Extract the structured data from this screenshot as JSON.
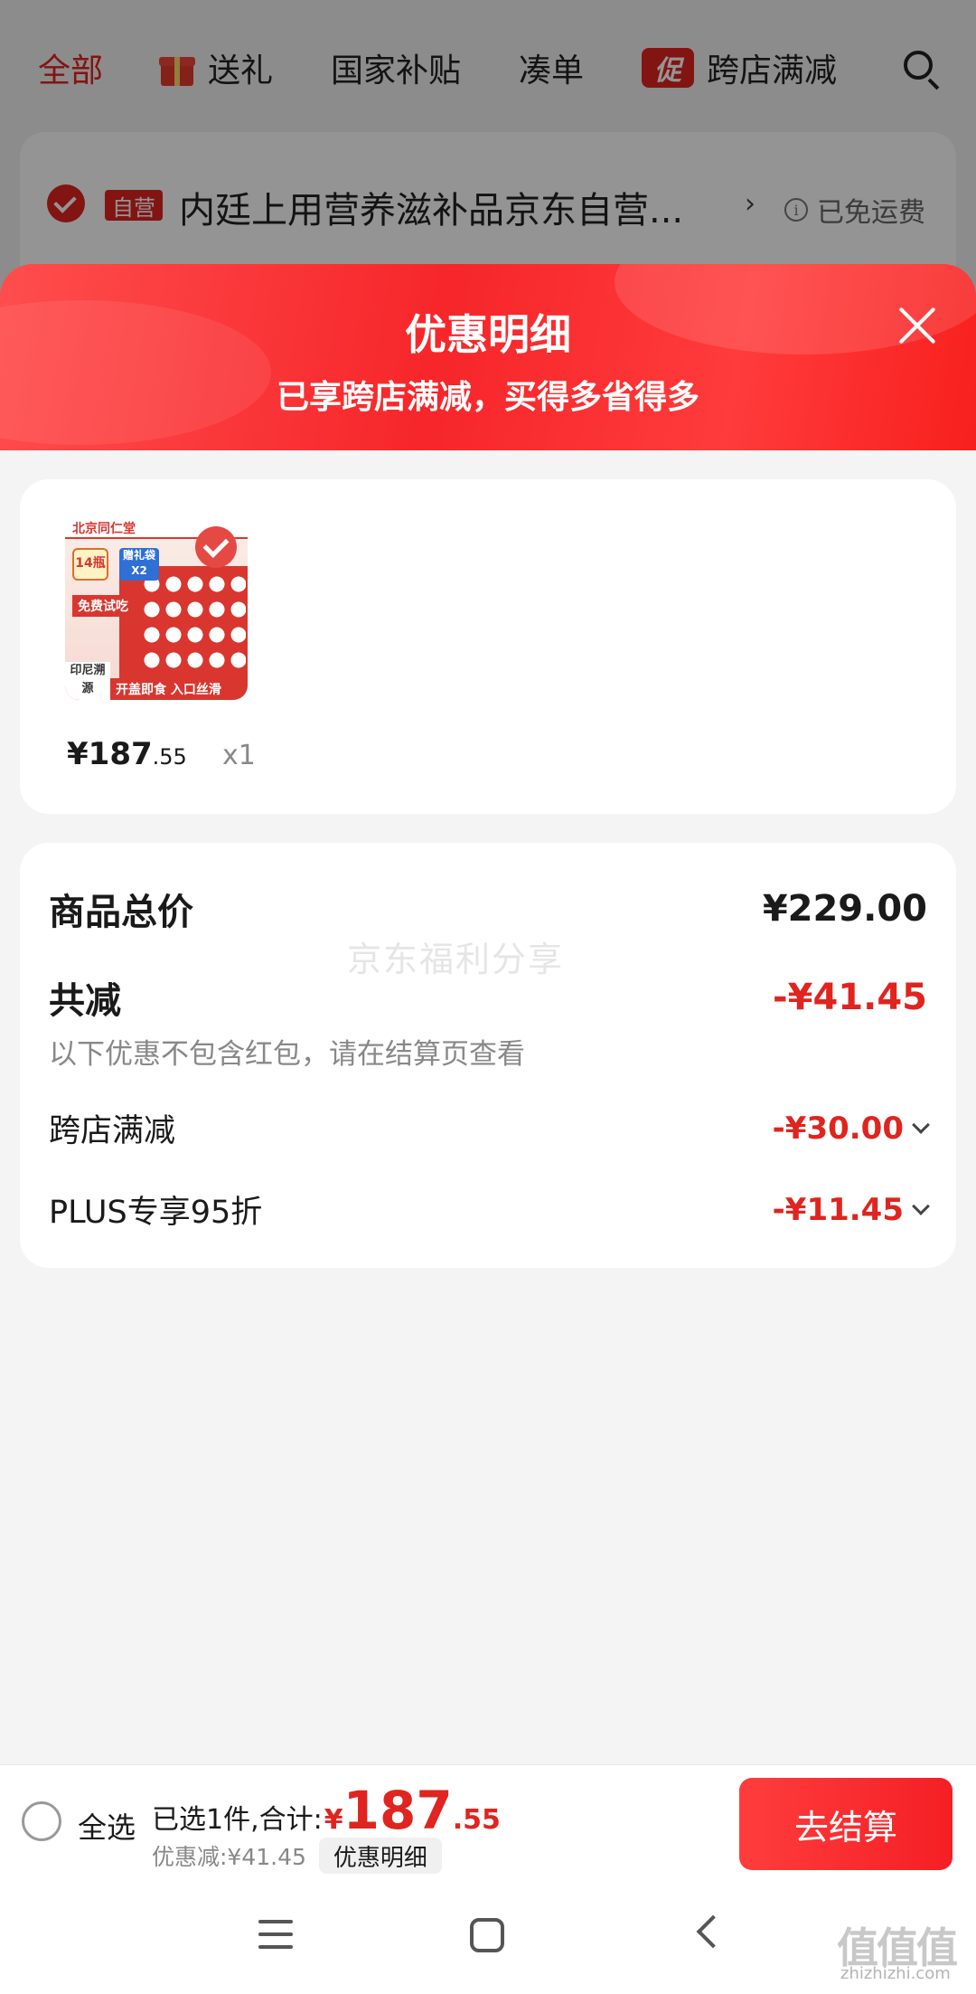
{
  "background": {
    "tabs": [
      {
        "label": "全部",
        "active": true
      },
      {
        "label": "送礼",
        "icon": "gift-icon"
      },
      {
        "label": "国家补贴"
      },
      {
        "label": "凑单"
      },
      {
        "label": "跨店满减",
        "badge": "促"
      }
    ],
    "shop": {
      "badge": "自营",
      "name": "内廷上用营养滋补品京东自营...",
      "arrow": "›",
      "shipping": "已免运费"
    }
  },
  "sheet": {
    "title": "优惠明细",
    "subtitle": "已享跨店满减，买得多省得多",
    "product": {
      "thumb_texts": {
        "brand": "北京同仁堂",
        "badge": "14瓶",
        "free_trial": "免费试吃",
        "gift": "赠礼袋X2",
        "origin": "印尼溯源",
        "bottom": "开盖即食 入口丝滑"
      },
      "price_int": "¥187",
      "price_dec": ".55",
      "qty": "x1"
    },
    "summary": {
      "total_label": "商品总价",
      "total_value": "¥229.00",
      "reduce_label": "共减",
      "reduce_value": "-¥41.45",
      "hint": "以下优惠不包含红包，请在结算页查看",
      "items": [
        {
          "label": "跨店满减",
          "value": "-¥30.00"
        },
        {
          "label": "PLUS专享95折",
          "value": "-¥11.45"
        }
      ],
      "watermark": "京东福利分享"
    }
  },
  "cart_bar": {
    "select_all": "全选",
    "total_label": "已选1件,合计:",
    "currency": "¥",
    "total_int": "187",
    "total_dec": ".55",
    "discount": "优惠减:¥41.45",
    "detail_button": "优惠明细",
    "checkout": "去结算"
  },
  "watermark_site": {
    "mark": "值值值",
    "url": "zhizhizhi.com"
  },
  "colors": {
    "accent": "#e0241f",
    "sheet_header": "#f6262a"
  }
}
